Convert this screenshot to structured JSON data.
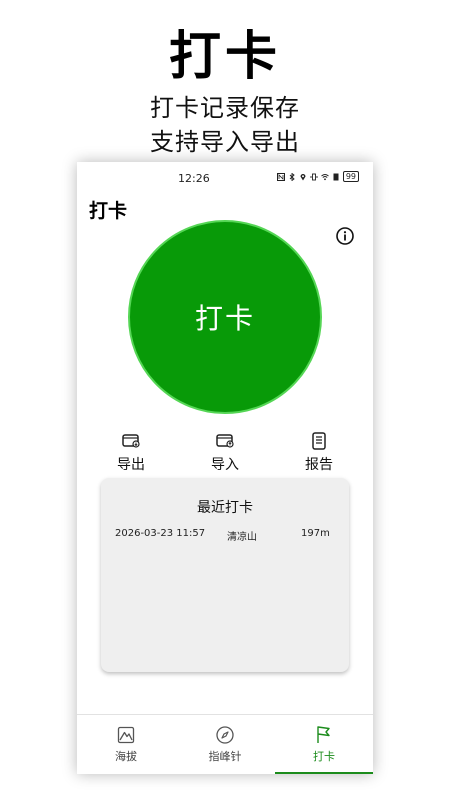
{
  "promo": {
    "title": "打卡",
    "line1": "打卡记录保存",
    "line2": "支持导入导出"
  },
  "status_bar": {
    "time": "12:26",
    "battery": "99"
  },
  "app": {
    "title": "打卡",
    "checkin_button": "打卡"
  },
  "actions": {
    "export_label": "导出",
    "import_label": "导入",
    "report_label": "报告"
  },
  "recent": {
    "title": "最近打卡",
    "records": [
      {
        "time": "2026-03-23 11:57",
        "place": "清凉山",
        "altitude": "197m"
      }
    ]
  },
  "nav": {
    "items": [
      {
        "label": "海拔",
        "icon": "mountain-icon"
      },
      {
        "label": "指峰针",
        "icon": "compass-icon"
      },
      {
        "label": "打卡",
        "icon": "flag-icon"
      }
    ],
    "active_index": 2
  },
  "colors": {
    "accent": "#089a08",
    "nav_active": "#1c8c1c"
  }
}
